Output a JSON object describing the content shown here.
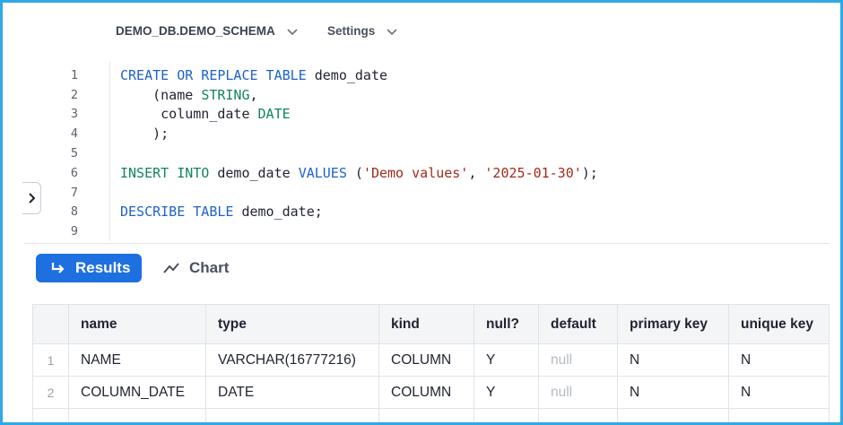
{
  "header": {
    "schema_label": "DEMO_DB.DEMO_SCHEMA",
    "settings_label": "Settings"
  },
  "editor": {
    "line_numbers": [
      "1",
      "2",
      "3",
      "4",
      "5",
      "6",
      "7",
      "8",
      "9"
    ],
    "l1a": "CREATE OR REPLACE TABLE",
    "l1b": " demo_date",
    "l2a": "    (name ",
    "l2b": "STRING",
    "l2c": ",",
    "l3a": "     column_date ",
    "l3b": "DATE",
    "l4": "    );",
    "l6a": "INSERT INTO",
    "l6b": " demo_date ",
    "l6c": "VALUES",
    "l6d": " (",
    "l6e": "'Demo values'",
    "l6f": ", ",
    "l6g": "'2025-01-30'",
    "l6h": ");",
    "l8a": "DESCRIBE TABLE",
    "l8b": " demo_date;"
  },
  "tabs": {
    "results_label": "Results",
    "chart_label": "Chart"
  },
  "table": {
    "columns": [
      "name",
      "type",
      "kind",
      "null?",
      "default",
      "primary key",
      "unique key"
    ],
    "rows": [
      {
        "index": "1",
        "cells": [
          "NAME",
          "VARCHAR(16777216)",
          "COLUMN",
          "Y",
          "null",
          "N",
          "N"
        ]
      },
      {
        "index": "2",
        "cells": [
          "COLUMN_DATE",
          "DATE",
          "COLUMN",
          "Y",
          "null",
          "N",
          "N"
        ]
      }
    ]
  },
  "icons": {
    "schema_chevron": "chevron-down-icon",
    "settings_chevron": "chevron-down-icon",
    "side_toggle": "chevron-right-icon",
    "results_icon": "return-arrow-icon",
    "chart_icon": "line-chart-icon"
  },
  "colors": {
    "accent": "#1e6fe0",
    "frame": "#2fa8e6",
    "keyword_blue": "#1d62c9",
    "keyword_green": "#12855a",
    "string": "#a12a1c"
  }
}
